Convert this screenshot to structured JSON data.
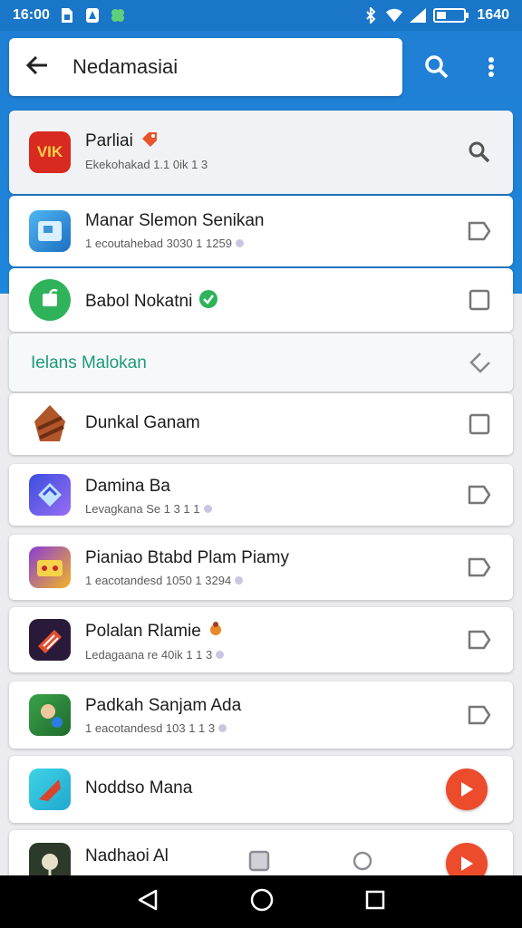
{
  "status_bar": {
    "time": "16:00",
    "battery_text": "1640"
  },
  "search": {
    "query": "Nedamasiai"
  },
  "header_item": {
    "title": "Parliai",
    "subtitle": "Ekekohakad 1.1 0ik 1 3",
    "icon_text": "VIK"
  },
  "apps": [
    {
      "title": "Manar Slemon Senikan",
      "subtitle": "1 ecoutahebad 3030 1 1259"
    },
    {
      "title": "Babol Nokatni",
      "subtitle": ""
    }
  ],
  "section": {
    "label": "Ielans Malokan"
  },
  "apps2": [
    {
      "title": "Dunkal Ganam",
      "subtitle": ""
    },
    {
      "title": "Damina Ba",
      "subtitle": "Levagkana Se 1 3 1 1"
    },
    {
      "title": "Pianiao Btabd Plam Piamy",
      "subtitle": "1 eacotandesd 1050 1 3294"
    },
    {
      "title": "Polalan Rlamie",
      "subtitle": "Ledagaana re 40ik 1 1 3"
    },
    {
      "title": "Padkah Sanjam Ada",
      "subtitle": "1 eacotandesd 103 1 1 3"
    },
    {
      "title": "Noddso Mana",
      "subtitle": ""
    },
    {
      "title": "Nadhaoi Al",
      "subtitle": ""
    }
  ],
  "colors": {
    "primary": "#1a76c9",
    "accent_play": "#ec4b2c",
    "verified": "#2fb35a",
    "section_text": "#1e9a7a"
  }
}
